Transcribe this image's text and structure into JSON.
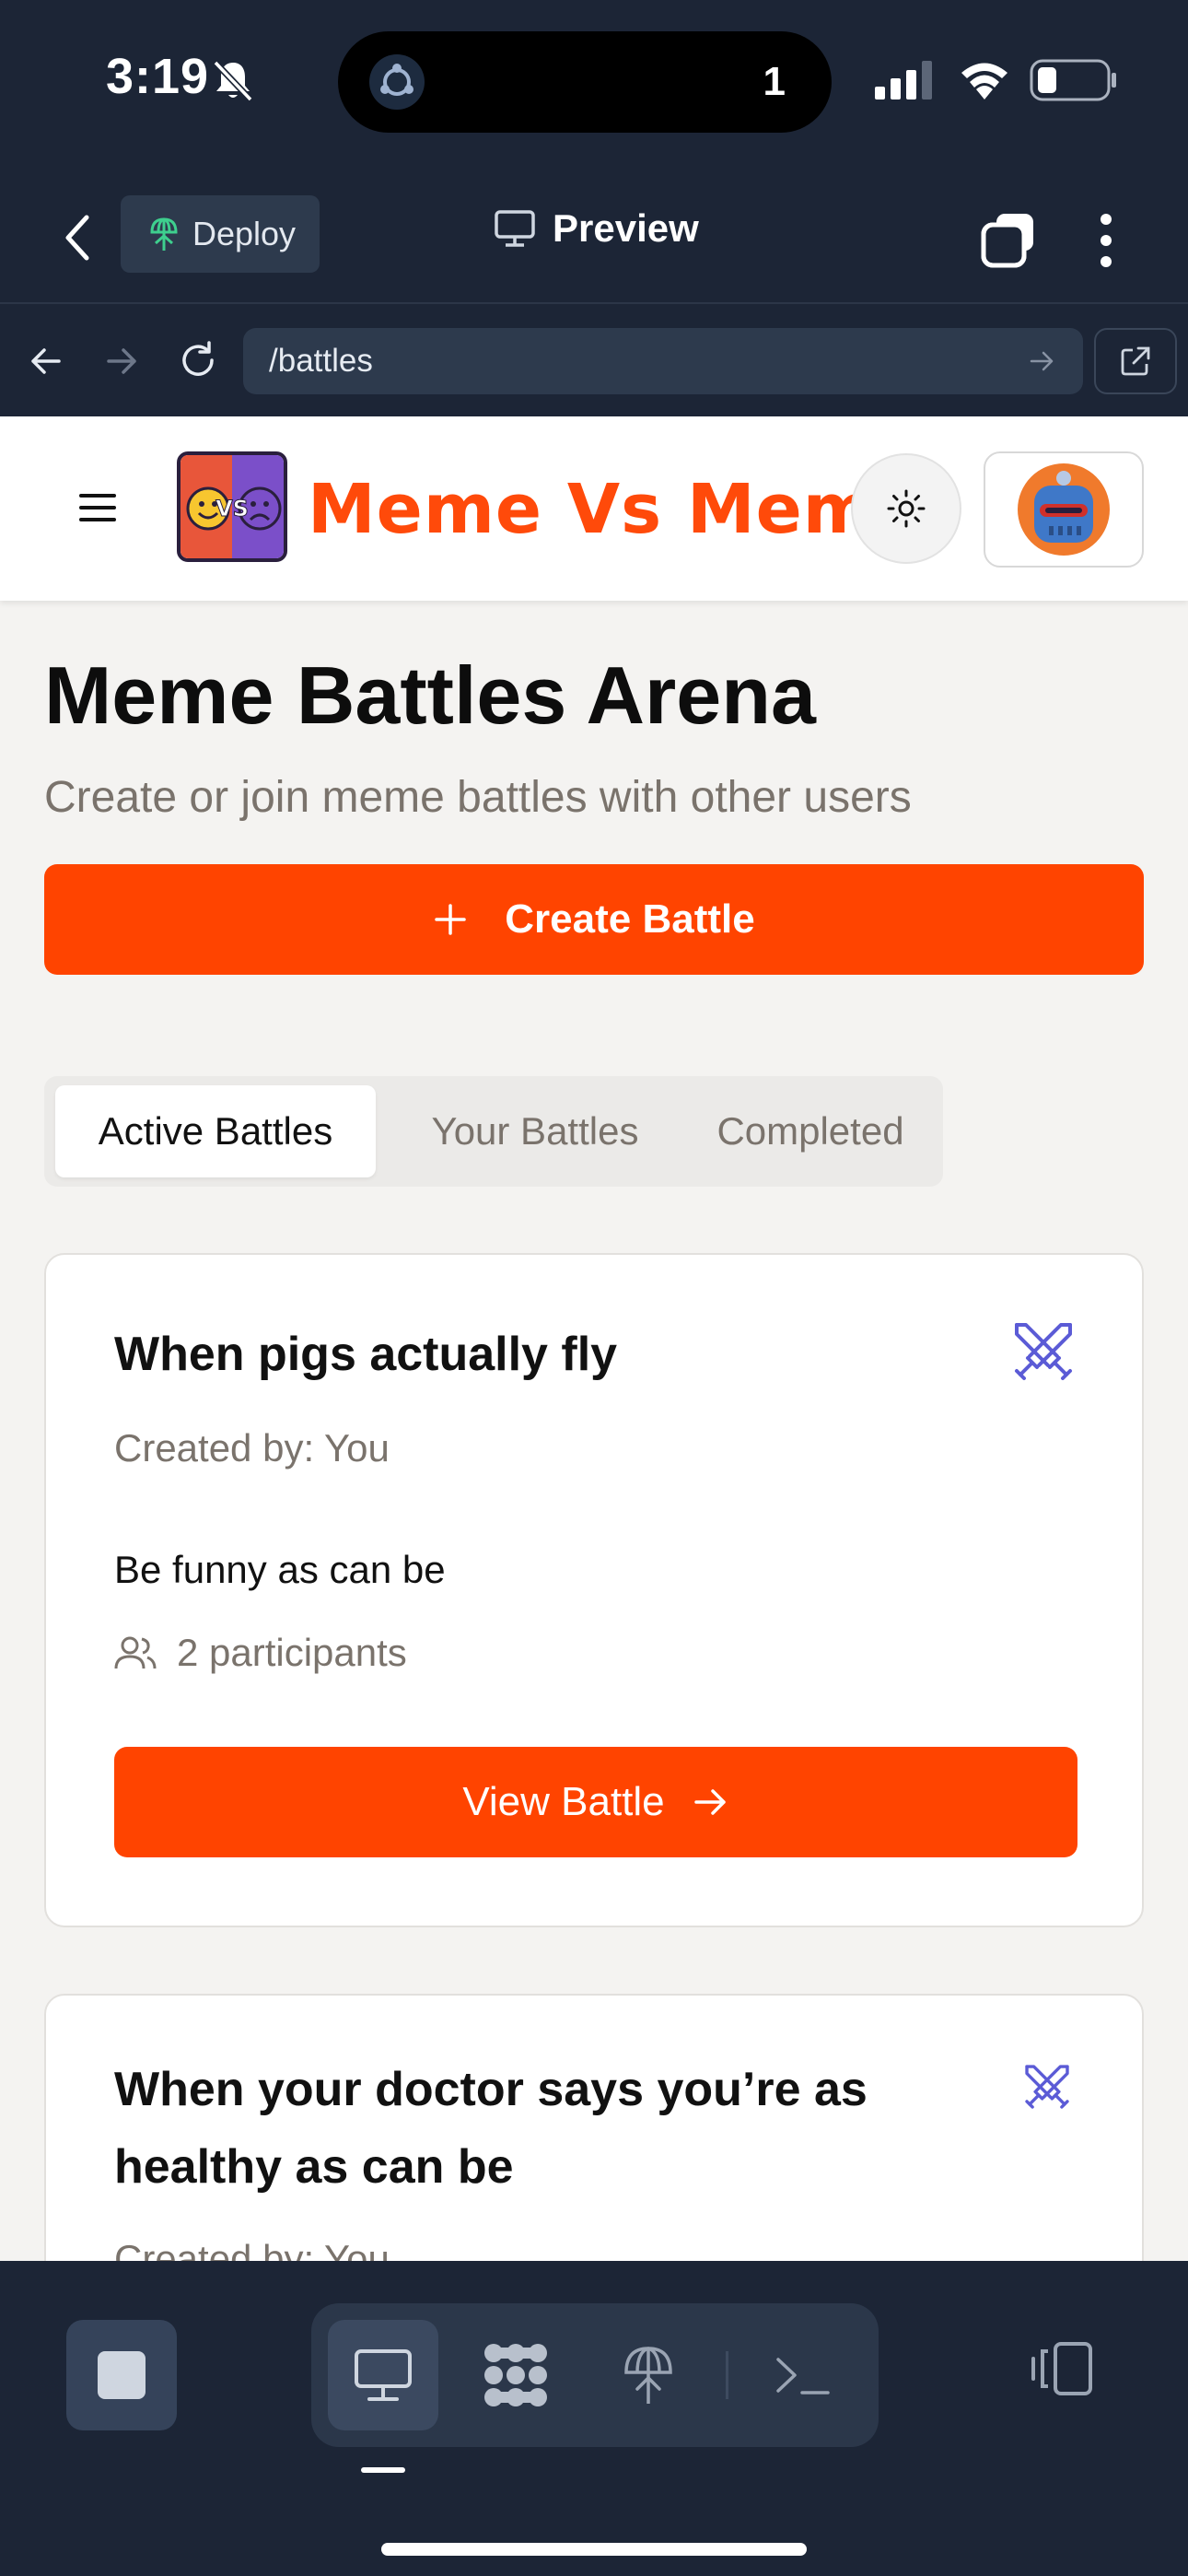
{
  "status_bar": {
    "time": "3:19",
    "island_count": "1"
  },
  "app_header": {
    "deploy_label": "Deploy",
    "preview_label": "Preview"
  },
  "browser": {
    "url": "/battles"
  },
  "site": {
    "brand": "Meme Vs Meme",
    "logo_text": "VS",
    "title": "Meme Battles Arena",
    "subtitle": "Create or join meme battles with other users",
    "create_button": "Create Battle",
    "tabs": [
      {
        "label": "Active Battles",
        "active": true
      },
      {
        "label": "Your Battles",
        "active": false
      },
      {
        "label": "Completed",
        "active": false
      }
    ]
  },
  "battles": [
    {
      "title": "When pigs actually fly",
      "created_by": "Created by: You",
      "description": "Be funny as can be",
      "participants": "2 participants",
      "button": "View Battle"
    },
    {
      "title": "When your doctor says you’re as healthy as can be",
      "created_by": "Created by: You"
    }
  ],
  "colors": {
    "accent": "#ff4400",
    "brand": "#ff4a0a",
    "chrome": "#1c2536",
    "battle_icon": "#5b5bd6"
  },
  "icons": {
    "battle": "swords-icon",
    "participants": "users-icon",
    "theme": "sun-icon"
  }
}
